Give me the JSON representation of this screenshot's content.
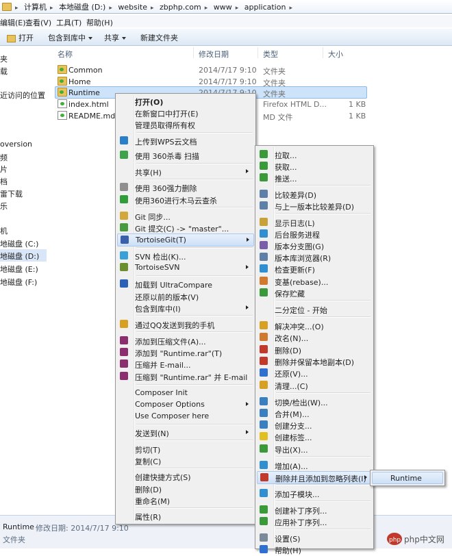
{
  "address": [
    "计算机",
    "本地磁盘 (D:)",
    "website",
    "zbphp.com",
    "www",
    "application"
  ],
  "menubar": [
    "编辑(E)",
    "查看(V)",
    "工具(T)",
    "帮助(H)"
  ],
  "toolbar": {
    "open": "打开",
    "library": "包含到库中",
    "share": "共享",
    "new_folder": "新建文件夹"
  },
  "nav": [
    "夹",
    "载",
    "近访问的位置",
    "oversion",
    "频",
    "片",
    "档",
    "雷下载",
    "乐",
    "机",
    "地磁盘 (C:)",
    "地磁盘 (D:)",
    "地磁盘 (E:)",
    "地磁盘 (F:)"
  ],
  "columns": {
    "name": "名称",
    "date": "修改日期",
    "type": "类型",
    "size": "大小"
  },
  "files": [
    {
      "name": "Common",
      "date": "2014/7/17 9:10",
      "type": "文件夹",
      "size": ""
    },
    {
      "name": "Home",
      "date": "2014/7/17 9:10",
      "type": "文件夹",
      "size": ""
    },
    {
      "name": "Runtime",
      "date": "2014/7/17 9:10",
      "type": "文件夹",
      "size": ""
    },
    {
      "name": "index.html",
      "date": "",
      "type": "Firefox HTML D...",
      "size": "1 KB"
    },
    {
      "name": "README.md",
      "date": "",
      "type": "MD 文件",
      "size": "1 KB"
    }
  ],
  "status": {
    "name": "Runtime",
    "date_label": "修改日期: 2014/7/17 9:10",
    "type": "文件夹"
  },
  "context_menu": [
    "打开(O)",
    "在新窗口中打开(E)",
    "管理员取得所有权",
    "上传到WPS云文档",
    "使用 360杀毒 扫描",
    "共享(H)",
    "使用 360强力删除",
    "使用360进行木马云查杀",
    "Git 同步...",
    "Git 提交(C) -> \"master\"...",
    "TortoiseGit(T)",
    "SVN 检出(K)...",
    "TortoiseSVN",
    "加载到 UltraCompare",
    "还原以前的版本(V)",
    "包含到库中(I)",
    "通过QQ发送到我的手机",
    "添加到压缩文件(A)...",
    "添加到 \"Runtime.rar\"(T)",
    "压缩并 E-mail...",
    "压缩到 \"Runtime.rar\" 并 E-mail",
    "Composer Init",
    "Composer Options",
    "Use Composer here",
    "发送到(N)",
    "剪切(T)",
    "复制(C)",
    "创建快捷方式(S)",
    "删除(D)",
    "重命名(M)",
    "属性(R)"
  ],
  "git_menu": [
    "拉取...",
    "获取...",
    "推送...",
    "比较差异(D)",
    "与上一版本比较差异(D)",
    "显示日志(L)",
    "后台服务进程",
    "版本分支图(G)",
    "版本库浏览器(R)",
    "检查更新(F)",
    "变基(rebase)...",
    "保存贮藏",
    "二分定位 - 开始",
    "解决冲突...(O)",
    "改名(N)...",
    "删除(D)",
    "删除并保留本地副本(D)",
    "还原(V)...",
    "清理...(C)",
    "切换/检出(W)...",
    "合并(M)...",
    "创建分支...",
    "创建标签...",
    "导出(X)...",
    "增加(A)...",
    "删除并且添加到忽略列表(I)",
    "添加子模块...",
    "创建补丁序列...",
    "应用补丁序列...",
    "设置(S)",
    "帮助(H)"
  ],
  "ignore_submenu": [
    "Runtime"
  ],
  "watermark": "php中文网"
}
